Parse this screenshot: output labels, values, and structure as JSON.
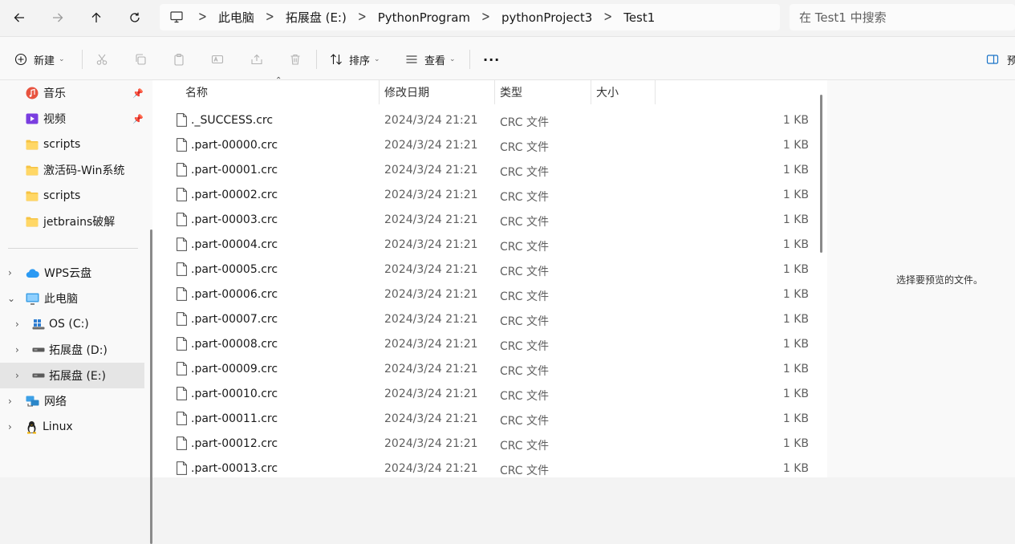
{
  "nav": {
    "back_icon": "arrow-left-icon",
    "forward_icon": "arrow-right-icon",
    "up_icon": "arrow-up-icon",
    "refresh_icon": "refresh-icon"
  },
  "address": {
    "icon": "computer-icon",
    "crumbs": [
      "此电脑",
      "拓展盘 (E:)",
      "PythonProgram",
      "pythonProject3",
      "Test1"
    ]
  },
  "search": {
    "placeholder": "在 Test1 中搜索"
  },
  "toolbar": {
    "new_label": "新建",
    "sort_label": "排序",
    "view_label": "查看",
    "more_label": "···",
    "preview_label": "预"
  },
  "sidebar": {
    "quick": [
      {
        "label": "音乐",
        "icon": "music-icon",
        "pinned": true
      },
      {
        "label": "视频",
        "icon": "video-icon",
        "pinned": true
      },
      {
        "label": "scripts",
        "icon": "folder-icon",
        "pinned": false
      },
      {
        "label": "激活码-Win系统",
        "icon": "folder-icon",
        "pinned": false
      },
      {
        "label": "scripts",
        "icon": "folder-icon",
        "pinned": false
      },
      {
        "label": "jetbrains破解",
        "icon": "folder-icon",
        "pinned": false
      }
    ],
    "tree": [
      {
        "label": "WPS云盘",
        "icon": "cloud-icon",
        "expanded": false,
        "level": 0,
        "selected": false
      },
      {
        "label": "此电脑",
        "icon": "computer-icon",
        "expanded": true,
        "level": 0,
        "selected": false
      },
      {
        "label": "OS (C:)",
        "icon": "windows-drive-icon",
        "expanded": false,
        "level": 1,
        "selected": false
      },
      {
        "label": "拓展盘 (D:)",
        "icon": "drive-icon",
        "expanded": false,
        "level": 1,
        "selected": false
      },
      {
        "label": "拓展盘 (E:)",
        "icon": "drive-icon",
        "expanded": false,
        "level": 1,
        "selected": true
      },
      {
        "label": "网络",
        "icon": "network-icon",
        "expanded": false,
        "level": 0,
        "selected": false
      },
      {
        "label": "Linux",
        "icon": "linux-icon",
        "expanded": false,
        "level": 0,
        "selected": false
      }
    ]
  },
  "columns": {
    "name": "名称",
    "date": "修改日期",
    "type": "类型",
    "size": "大小"
  },
  "files": [
    {
      "name": "._SUCCESS.crc",
      "date": "2024/3/24 21:21",
      "type": "CRC 文件",
      "size": "1 KB"
    },
    {
      "name": ".part-00000.crc",
      "date": "2024/3/24 21:21",
      "type": "CRC 文件",
      "size": "1 KB"
    },
    {
      "name": ".part-00001.crc",
      "date": "2024/3/24 21:21",
      "type": "CRC 文件",
      "size": "1 KB"
    },
    {
      "name": ".part-00002.crc",
      "date": "2024/3/24 21:21",
      "type": "CRC 文件",
      "size": "1 KB"
    },
    {
      "name": ".part-00003.crc",
      "date": "2024/3/24 21:21",
      "type": "CRC 文件",
      "size": "1 KB"
    },
    {
      "name": ".part-00004.crc",
      "date": "2024/3/24 21:21",
      "type": "CRC 文件",
      "size": "1 KB"
    },
    {
      "name": ".part-00005.crc",
      "date": "2024/3/24 21:21",
      "type": "CRC 文件",
      "size": "1 KB"
    },
    {
      "name": ".part-00006.crc",
      "date": "2024/3/24 21:21",
      "type": "CRC 文件",
      "size": "1 KB"
    },
    {
      "name": ".part-00007.crc",
      "date": "2024/3/24 21:21",
      "type": "CRC 文件",
      "size": "1 KB"
    },
    {
      "name": ".part-00008.crc",
      "date": "2024/3/24 21:21",
      "type": "CRC 文件",
      "size": "1 KB"
    },
    {
      "name": ".part-00009.crc",
      "date": "2024/3/24 21:21",
      "type": "CRC 文件",
      "size": "1 KB"
    },
    {
      "name": ".part-00010.crc",
      "date": "2024/3/24 21:21",
      "type": "CRC 文件",
      "size": "1 KB"
    },
    {
      "name": ".part-00011.crc",
      "date": "2024/3/24 21:21",
      "type": "CRC 文件",
      "size": "1 KB"
    },
    {
      "name": ".part-00012.crc",
      "date": "2024/3/24 21:21",
      "type": "CRC 文件",
      "size": "1 KB"
    },
    {
      "name": ".part-00013.crc",
      "date": "2024/3/24 21:21",
      "type": "CRC 文件",
      "size": "1 KB"
    }
  ],
  "preview": {
    "message": "选择要预览的文件。"
  },
  "colors": {
    "window_bg": "#f3f3f3",
    "content_bg": "#ffffff",
    "selected_bg": "#e5e5e5",
    "muted_text": "#5f5f5f",
    "folder_yellow": "#f6c343",
    "accent_blue": "#1a73c8"
  }
}
